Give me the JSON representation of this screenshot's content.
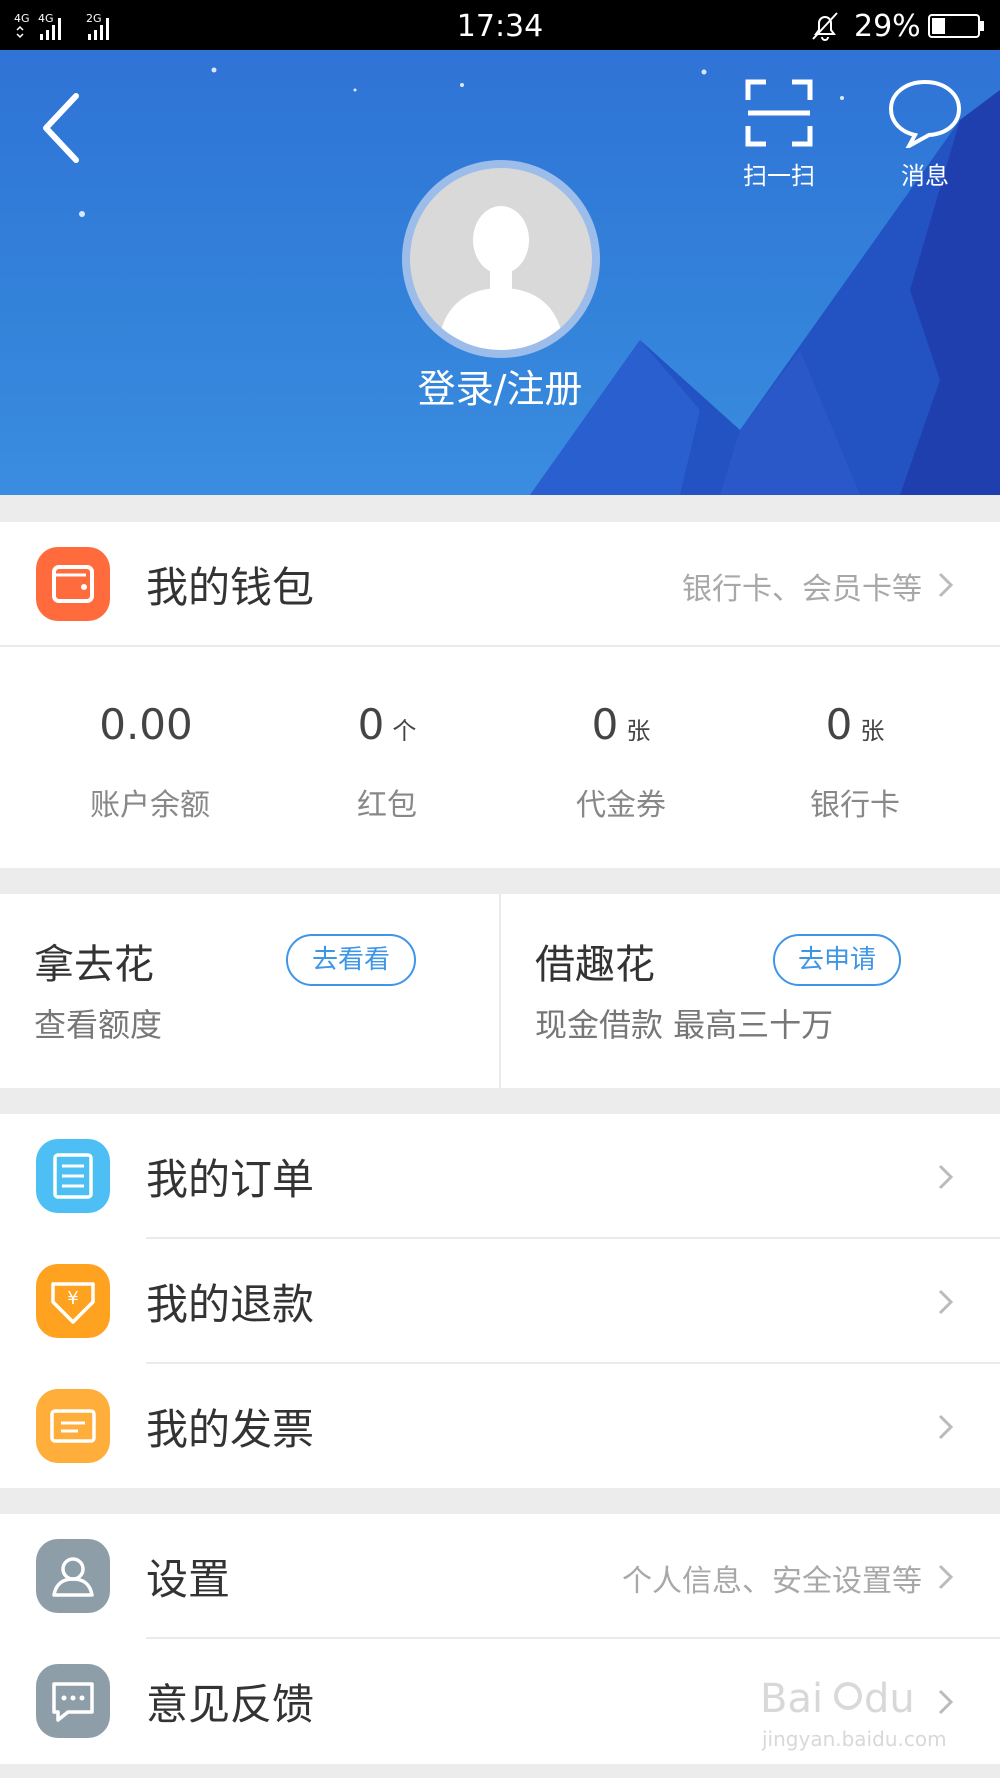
{
  "status_bar": {
    "network": "4G 4G 2G",
    "time": "17:34",
    "battery": "29%"
  },
  "header": {
    "scan_label": "扫一扫",
    "message_label": "消息",
    "login_label": "登录/注册"
  },
  "wallet": {
    "title": "我的钱包",
    "subtitle": "银行卡、会员卡等",
    "icon_color": "#ff6b3d",
    "stats": [
      {
        "value": "0.00",
        "unit": "",
        "label": "账户余额"
      },
      {
        "value": "0",
        "unit": "个",
        "label": "红包"
      },
      {
        "value": "0",
        "unit": "张",
        "label": "代金券"
      },
      {
        "value": "0",
        "unit": "张",
        "label": "银行卡"
      }
    ]
  },
  "credit": [
    {
      "name": "拿去花",
      "button": "去看看",
      "desc": "查看额度"
    },
    {
      "name": "借趣花",
      "button": "去申请",
      "desc": "现金借款 最高三十万"
    }
  ],
  "menu": {
    "orders": {
      "title": "我的订单",
      "icon": "order-list-icon",
      "color": "#4dbff5"
    },
    "refunds": {
      "title": "我的退款",
      "icon": "refund-yen-icon",
      "color": "#ffa21f"
    },
    "invoices": {
      "title": "我的发票",
      "icon": "invoice-icon",
      "color": "#ffad3b"
    }
  },
  "settings": {
    "settings": {
      "title": "设置",
      "subtitle": "个人信息、安全设置等",
      "color": "#8e9ea9"
    },
    "feedback": {
      "title": "意见反馈",
      "color": "#8e9ea9"
    }
  },
  "watermark": {
    "brand": "Baidu经验",
    "url": "jingyan.baidu.com"
  }
}
